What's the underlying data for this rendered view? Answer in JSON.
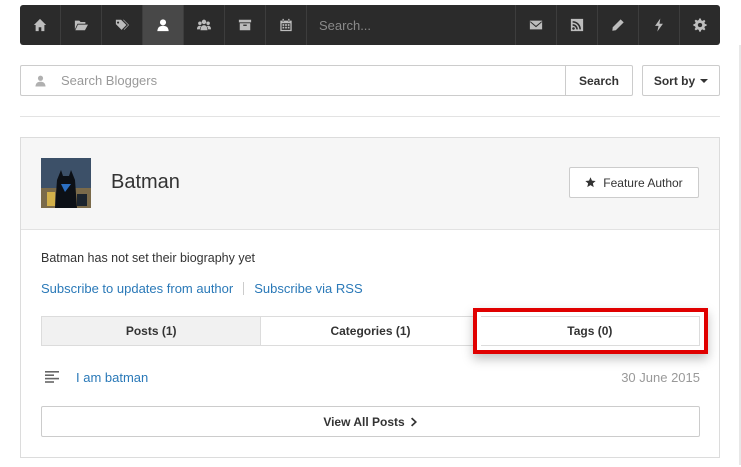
{
  "toolbar": {
    "search_placeholder": "Search...",
    "left_icons": [
      "home-icon",
      "folder-open-icon",
      "tags-icon",
      "user-icon",
      "users-icon",
      "archive-icon",
      "calendar-icon"
    ],
    "active_icon": "user-icon",
    "right_icons": [
      "envelope-icon",
      "rss-icon",
      "pencil-icon",
      "bolt-icon",
      "gear-icon"
    ]
  },
  "search": {
    "placeholder": "Search Bloggers",
    "button_label": "Search",
    "sort_label": "Sort by"
  },
  "author": {
    "name": "Batman",
    "feature_label": "Feature Author",
    "bio": "Batman has not set their biography yet",
    "subscribe_author": "Subscribe to updates from author",
    "subscribe_rss": "Subscribe via RSS"
  },
  "tabs": [
    {
      "label": "Posts (1)",
      "active": true
    },
    {
      "label": "Categories (1)",
      "active": false
    },
    {
      "label": "Tags (0)",
      "active": false,
      "highlighted": true
    }
  ],
  "posts": [
    {
      "title": "I am batman",
      "date": "30 June 2015"
    }
  ],
  "view_all_label": "View All Posts",
  "colors": {
    "toolbar_bg": "#2b2b2b",
    "link": "#2a79b8",
    "highlight": "#e00000"
  }
}
